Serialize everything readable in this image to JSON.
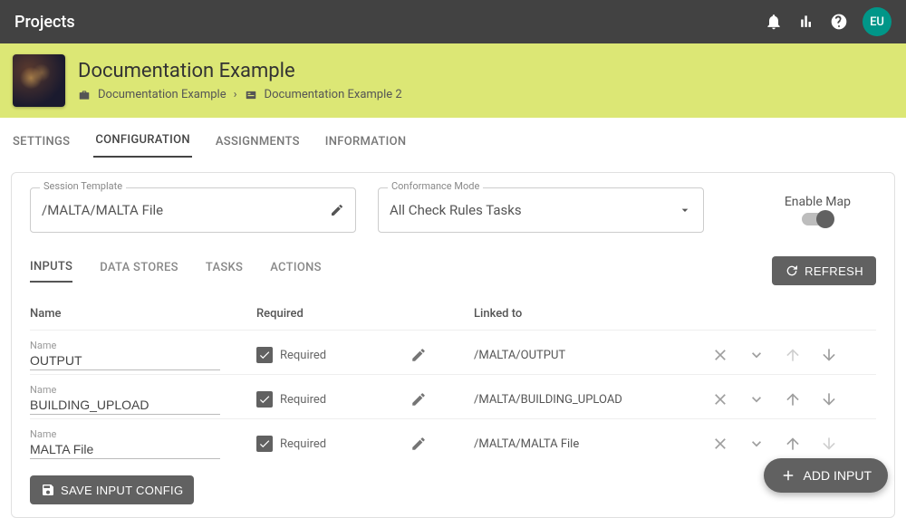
{
  "topbar": {
    "title": "Projects",
    "avatar": "EU"
  },
  "banner": {
    "title": "Documentation Example",
    "crumb1": "Documentation Example",
    "crumb2": "Documentation Example 2"
  },
  "mainTabs": {
    "settings": "SETTINGS",
    "configuration": "CONFIGURATION",
    "assignments": "ASSIGNMENTS",
    "information": "INFORMATION"
  },
  "session": {
    "label": "Session Template",
    "value": "/MALTA/MALTA File"
  },
  "conformance": {
    "label": "Conformance Mode",
    "value": "All Check Rules Tasks"
  },
  "map": {
    "label": "Enable Map"
  },
  "subTabs": {
    "inputs": "INPUTS",
    "datastores": "DATA STORES",
    "tasks": "TASKS",
    "actions": "ACTIONS"
  },
  "refresh": "REFRESH",
  "columns": {
    "name": "Name",
    "required": "Required",
    "linked": "Linked to"
  },
  "rows": [
    {
      "nameLabel": "Name",
      "name": "OUTPUT",
      "reqLabel": "Required",
      "linked": "/MALTA/OUTPUT",
      "upDim": true,
      "downDim": false
    },
    {
      "nameLabel": "Name",
      "name": "BUILDING_UPLOAD",
      "reqLabel": "Required",
      "linked": "/MALTA/BUILDING_UPLOAD",
      "upDim": false,
      "downDim": false
    },
    {
      "nameLabel": "Name",
      "name": "MALTA File",
      "reqLabel": "Required",
      "linked": "/MALTA/MALTA File",
      "upDim": false,
      "downDim": true
    }
  ],
  "saveBtn": "SAVE INPUT CONFIG",
  "addInput": "ADD INPUT"
}
